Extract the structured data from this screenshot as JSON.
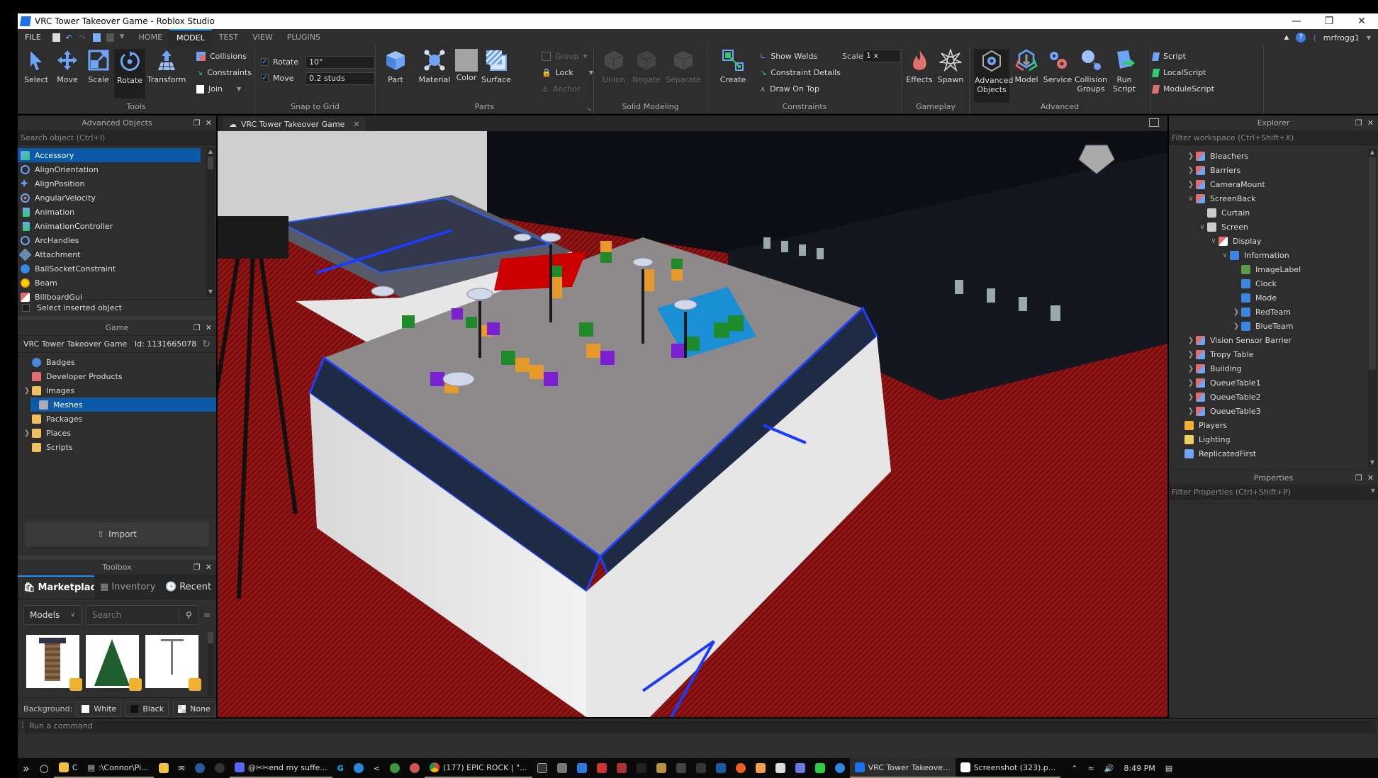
{
  "window": {
    "title": "VRC Tower Takeover Game - Roblox Studio",
    "controls": [
      "minimize",
      "restore",
      "close"
    ]
  },
  "menubar": {
    "file": "FILE",
    "tabs": [
      "HOME",
      "MODEL",
      "TEST",
      "VIEW",
      "PLUGINS"
    ],
    "active_tab": "MODEL",
    "user": "mrfrogg1"
  },
  "ribbon": {
    "tools": {
      "label": "Tools",
      "buttons": [
        "Select",
        "Move",
        "Scale",
        "Rotate",
        "Transform"
      ],
      "selected": "Rotate",
      "options": [
        "Collisions",
        "Constraints",
        "Join"
      ]
    },
    "snap": {
      "label": "Snap to Grid",
      "rotate_label": "Rotate",
      "rotate_value": "10°",
      "rotate_checked": true,
      "move_label": "Move",
      "move_value": "0.2 studs",
      "move_checked": true
    },
    "parts": {
      "label": "Parts",
      "buttons": [
        "Part",
        "Material",
        "Color",
        "Surface"
      ],
      "options": [
        "Group",
        "Lock",
        "Anchor"
      ]
    },
    "solid": {
      "label": "Solid Modeling",
      "buttons": [
        "Union",
        "Negate",
        "Separate"
      ]
    },
    "constraints": {
      "label": "Constraints",
      "create": "Create",
      "options": [
        "Show Welds",
        "Constraint Details",
        "Draw On Top"
      ],
      "scale_label": "Scale",
      "scale_value": "1 x"
    },
    "gameplay": {
      "label": "Gameplay",
      "buttons": [
        "Effects",
        "Spawn"
      ]
    },
    "advanced": {
      "label": "Advanced",
      "buttons": [
        "Advanced Objects",
        "Model",
        "Service",
        "Collision Groups",
        "Run Script"
      ],
      "scripts": [
        "Script",
        "LocalScript",
        "ModuleScript"
      ]
    }
  },
  "advanced_objects": {
    "title": "Advanced Objects",
    "search_placeholder": "Search object (Ctrl+I)",
    "items": [
      "Accessory",
      "AlignOrientation",
      "AlignPosition",
      "AngularVelocity",
      "Animation",
      "AnimationController",
      "ArcHandles",
      "Attachment",
      "BallSocketConstraint",
      "Beam",
      "BillboardGui"
    ],
    "selected": "Accessory",
    "select_inserted": "Select inserted object"
  },
  "game": {
    "title": "Game",
    "name": "VRC Tower Takeover Game",
    "id": "Id: 1131665078",
    "items": [
      {
        "label": "Badges",
        "expandable": false
      },
      {
        "label": "Developer Products",
        "expandable": false
      },
      {
        "label": "Images",
        "expandable": true
      },
      {
        "label": "Meshes",
        "expandable": false,
        "selected": true
      },
      {
        "label": "Packages",
        "expandable": false
      },
      {
        "label": "Places",
        "expandable": true
      },
      {
        "label": "Scripts",
        "expandable": false
      }
    ],
    "import": "Import"
  },
  "toolbox": {
    "title": "Toolbox",
    "tabs": [
      "Marketplace",
      "Inventory",
      "Recent"
    ],
    "active_tab": "Marketplace",
    "category": "Models",
    "search_placeholder": "Search",
    "background_label": "Background:",
    "background_options": [
      "White",
      "Black",
      "None"
    ]
  },
  "viewport": {
    "tab": "VRC Tower Takeover Game"
  },
  "explorer": {
    "title": "Explorer",
    "filter_placeholder": "Filter workspace (Ctrl+Shift+X)",
    "items": [
      {
        "label": "Bleachers",
        "depth": 1,
        "arrow": ">",
        "icon": "model"
      },
      {
        "label": "Barriers",
        "depth": 1,
        "arrow": ">",
        "icon": "model"
      },
      {
        "label": "CameraMount",
        "depth": 1,
        "arrow": ">",
        "icon": "model"
      },
      {
        "label": "ScreenBack",
        "depth": 1,
        "arrow": "v",
        "icon": "model"
      },
      {
        "label": "Curtain",
        "depth": 2,
        "arrow": "",
        "icon": "part"
      },
      {
        "label": "Screen",
        "depth": 2,
        "arrow": "v",
        "icon": "part"
      },
      {
        "label": "Display",
        "depth": 3,
        "arrow": "v",
        "icon": "gui"
      },
      {
        "label": "Information",
        "depth": 4,
        "arrow": "v",
        "icon": "frame"
      },
      {
        "label": "ImageLabel",
        "depth": 5,
        "arrow": "",
        "icon": "image"
      },
      {
        "label": "Clock",
        "depth": 5,
        "arrow": "",
        "icon": "text"
      },
      {
        "label": "Mode",
        "depth": 5,
        "arrow": "",
        "icon": "text"
      },
      {
        "label": "RedTeam",
        "depth": 5,
        "arrow": ">",
        "icon": "text"
      },
      {
        "label": "BlueTeam",
        "depth": 5,
        "arrow": ">",
        "icon": "text"
      },
      {
        "label": "Vision Sensor Barrier",
        "depth": 1,
        "arrow": ">",
        "icon": "model"
      },
      {
        "label": "Tropy Table",
        "depth": 1,
        "arrow": ">",
        "icon": "model"
      },
      {
        "label": "Building",
        "depth": 1,
        "arrow": ">",
        "icon": "model"
      },
      {
        "label": "QueueTable1",
        "depth": 1,
        "arrow": ">",
        "icon": "model"
      },
      {
        "label": "QueueTable2",
        "depth": 1,
        "arrow": ">",
        "icon": "model"
      },
      {
        "label": "QueueTable3",
        "depth": 1,
        "arrow": ">",
        "icon": "model"
      },
      {
        "label": "Players",
        "depth": 0,
        "arrow": "",
        "icon": "players"
      },
      {
        "label": "Lighting",
        "depth": 0,
        "arrow": "",
        "icon": "lighting"
      },
      {
        "label": "ReplicatedFirst",
        "depth": 0,
        "arrow": "",
        "icon": "replicated"
      }
    ]
  },
  "properties": {
    "title": "Properties",
    "filter_placeholder": "Filter Properties (Ctrl+Shift+P)"
  },
  "command_bar": {
    "placeholder": "Run a command"
  },
  "taskbar": {
    "items": [
      "C",
      ":\\Connor\\Pi...",
      "@✂✂end my suffe...",
      "(177) EPIC ROCK | \"...",
      "VRC Tower Takeove...",
      "Screenshot (323).p..."
    ],
    "time": "8:49 PM"
  }
}
